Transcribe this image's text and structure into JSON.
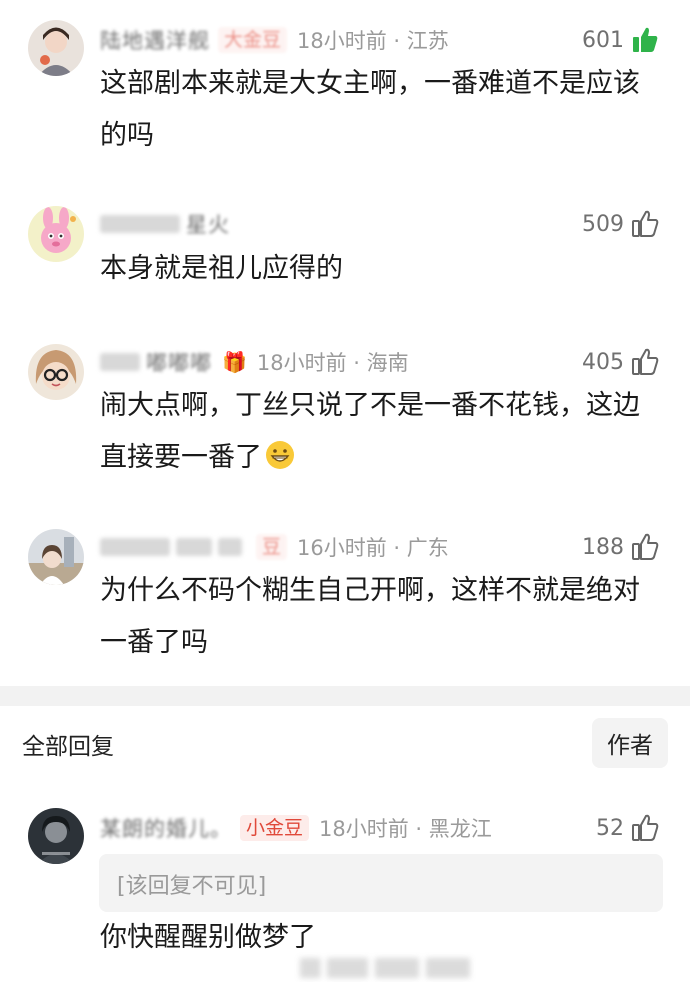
{
  "colors": {
    "accent_red": "#e0493a",
    "like_active_green": "#2fb34a",
    "muted_text": "#9a9a9a"
  },
  "comments": [
    {
      "username": "陆地遇洋舰",
      "badge": "大金豆",
      "time": "18小时前 · 江苏",
      "likes": "601",
      "liked": true,
      "text": "这部剧本来就是大女主啊，一番难道不是应该的吗"
    },
    {
      "username": "星火",
      "time": "",
      "likes": "509",
      "liked": false,
      "text": "本身就是祖儿应得的"
    },
    {
      "username": "嘟嘟嘟",
      "badge_icon": "gift-emoji-icon",
      "time": "18小时前 · 海南",
      "likes": "405",
      "liked": false,
      "text": "闹大点啊，丁丝只说了不是一番不花钱，这边直接要一番了"
    },
    {
      "username": "",
      "badge": "豆",
      "time": "16小时前 · 广东",
      "likes": "188",
      "liked": false,
      "text": "为什么不码个糊生自己开啊，这样不就是绝对一番了吗"
    }
  ],
  "replies_section": {
    "title": "全部回复",
    "author_filter": "作者"
  },
  "reply": {
    "username": "某朗的婚儿。",
    "badge": "小金豆",
    "time": "18小时前 · 黑龙江",
    "likes": "52",
    "hidden_quote": "[该回复不可见]",
    "text": "你快醒醒别做梦了"
  }
}
